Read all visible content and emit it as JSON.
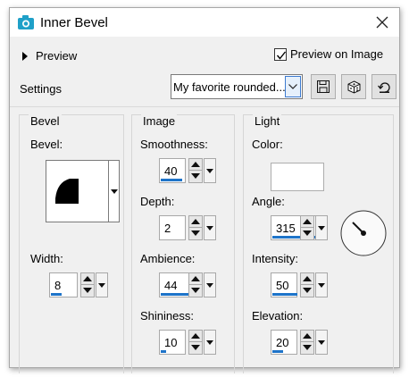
{
  "window": {
    "title": "Inner Bevel",
    "icon": "camera-icon"
  },
  "preview": {
    "label": "Preview",
    "checkbox_label": "Preview on Image",
    "checked": true
  },
  "settings": {
    "label": "Settings",
    "preset_value": "My favorite rounded..."
  },
  "toolbar": {
    "save_icon": "save-icon",
    "random_icon": "dice-icon",
    "reset_icon": "reset-icon"
  },
  "bevel_group": {
    "title": "Bevel",
    "bevel_label": "Bevel:",
    "width_label": "Width:",
    "width_value": "8"
  },
  "image_group": {
    "title": "Image",
    "smoothness_label": "Smoothness:",
    "smoothness_value": "40",
    "depth_label": "Depth:",
    "depth_value": "2",
    "ambience_label": "Ambience:",
    "ambience_value": "44",
    "shininess_label": "Shininess:",
    "shininess_value": "10"
  },
  "light_group": {
    "title": "Light",
    "color_label": "Color:",
    "color_value": "#ffffff",
    "angle_label": "Angle:",
    "angle_value": "315",
    "intensity_label": "Intensity:",
    "intensity_value": "50",
    "elevation_label": "Elevation:",
    "elevation_value": "20"
  },
  "colors": {
    "accent": "#1e74c9",
    "dialog_bg": "#f0f0f0"
  }
}
